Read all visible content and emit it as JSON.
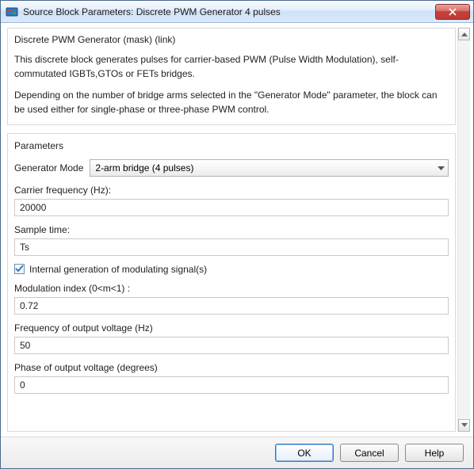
{
  "window": {
    "title": "Source Block Parameters: Discrete PWM Generator 4 pulses"
  },
  "description": {
    "heading": "Discrete PWM Generator (mask) (link)",
    "p1": "This discrete block generates pulses for carrier-based PWM (Pulse Width Modulation), self-commutated IGBTs,GTOs or FETs bridges.",
    "p2": "Depending on the number of bridge arms selected in the \"Generator Mode\" parameter, the block can be used either for single-phase or three-phase PWM control."
  },
  "parameters": {
    "heading": "Parameters",
    "generator_mode": {
      "label": "Generator Mode",
      "value": "2-arm  bridge (4 pulses)"
    },
    "carrier_freq": {
      "label": "Carrier frequency (Hz):",
      "value": "20000"
    },
    "sample_time": {
      "label": "Sample time:",
      "value": "Ts"
    },
    "internal_gen": {
      "label": "Internal generation of modulating signal(s)",
      "checked": true
    },
    "mod_index": {
      "label": "Modulation index  (0<m<1) :",
      "value": "0.72"
    },
    "out_freq": {
      "label": "Frequency of output voltage (Hz)",
      "value": "50"
    },
    "out_phase": {
      "label": "Phase of output voltage (degrees)",
      "value": "0"
    }
  },
  "buttons": {
    "ok": "OK",
    "cancel": "Cancel",
    "help": "Help"
  }
}
